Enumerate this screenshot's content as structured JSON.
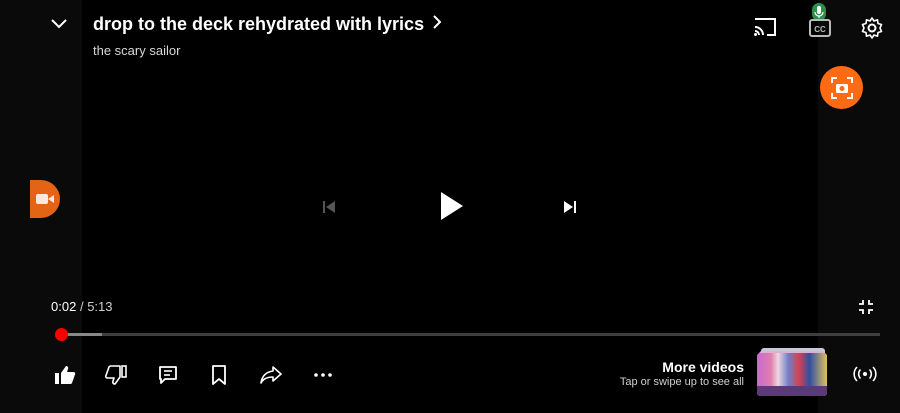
{
  "video": {
    "title": "drop to the deck rehydrated with lyrics",
    "channel": "the scary sailor"
  },
  "player": {
    "current_time": "0:02",
    "separator": "/",
    "total_time": "5:13",
    "progress_fraction": 0.006,
    "buffer_fraction": 0.055
  },
  "more_videos": {
    "title": "More videos",
    "subtitle": "Tap or swipe up to see all"
  },
  "icons": {
    "collapse": "chevron-down-icon",
    "title_arrow": "chevron-right-icon",
    "cast": "cast-icon",
    "captions": "cc-icon",
    "mic": "mic-icon",
    "settings": "gear-icon",
    "screenshot": "screenshot-camera-icon",
    "recorder": "video-camera-icon",
    "previous": "skip-previous-icon",
    "play": "play-icon",
    "next": "skip-next-icon",
    "fullscreen_exit": "fullscreen-exit-icon",
    "like": "thumbs-up-icon",
    "dislike": "thumbs-down-icon",
    "comments": "comment-icon",
    "save": "bookmark-icon",
    "share": "share-icon",
    "more": "more-horizontal-icon",
    "live": "broadcast-icon"
  },
  "colors": {
    "progress": "#ff0000",
    "accent_orange": "#ff6b15",
    "background": "#000000"
  }
}
